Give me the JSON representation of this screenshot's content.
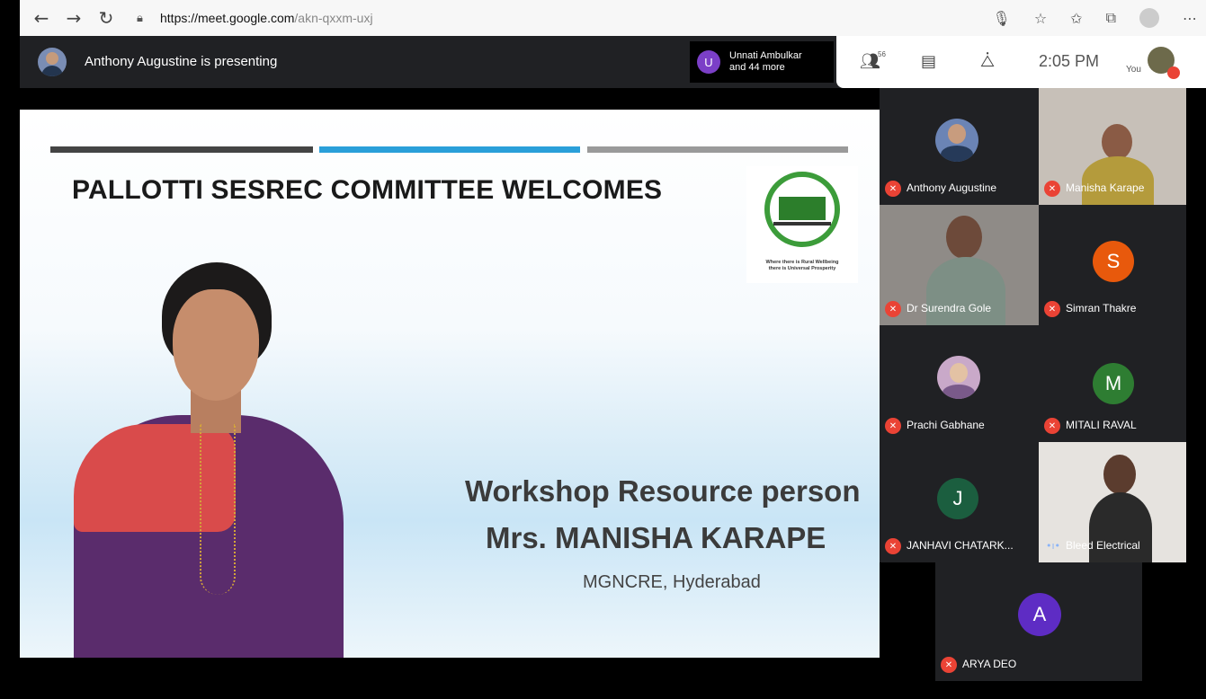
{
  "browser": {
    "back_icon": "arrow-left-icon",
    "forward_icon": "arrow-right-icon",
    "refresh_icon": "refresh-icon",
    "url_scheme_host": "https://meet.google.com",
    "url_path": "/akn-qxxm-uxj"
  },
  "meet_header": {
    "presenting_text": "Anthony Augustine is presenting",
    "others_avatar_letter": "U",
    "others_line1": "Unnati Ambulkar",
    "others_line2": "and 44 more",
    "participants_count": "56",
    "time": "2:05 PM",
    "you_label": "You",
    "colors": {
      "others_avatar": "#7b3fc7",
      "mic_off": "#ea4335"
    }
  },
  "slide": {
    "title": "PALLOTTI SESREC COMMITTEE WELCOMES",
    "logo_caption_line1": "Where there is Rural Wellbeing",
    "logo_caption_line2": "there is Universal Prosperity",
    "resource_title": "Workshop Resource person",
    "resource_name": "Mrs. MANISHA KARAPE",
    "resource_org": "MGNCRE, Hyderabad",
    "colors": {
      "bar_dark": "#444444",
      "bar_blue": "#2a9fd9",
      "bar_grey": "#9a9a9a"
    }
  },
  "participants": [
    {
      "name": "Anthony Augustine",
      "avatar_type": "photo",
      "muted": true
    },
    {
      "name": "Manisha Karape",
      "avatar_type": "camera",
      "muted": true
    },
    {
      "name": "Dr Surendra Gole",
      "avatar_type": "camera",
      "muted": true
    },
    {
      "name": "Simran Thakre",
      "avatar_type": "letter",
      "letter": "S",
      "color": "#e8590c",
      "muted": true
    },
    {
      "name": "Prachi Gabhane",
      "avatar_type": "photo",
      "muted": true
    },
    {
      "name": "MITALI RAVAL",
      "avatar_type": "letter",
      "letter": "M",
      "color": "#2e7d32",
      "muted": true
    },
    {
      "name": "JANHAVI CHATARK...",
      "avatar_type": "letter",
      "letter": "J",
      "color": "#1b5e3f",
      "muted": true
    },
    {
      "name": "Bleed Electrical",
      "avatar_type": "camera",
      "muted": false
    },
    {
      "name": "ARYA DEO",
      "avatar_type": "letter",
      "letter": "A",
      "color": "#5e2cc4",
      "muted": true
    }
  ]
}
